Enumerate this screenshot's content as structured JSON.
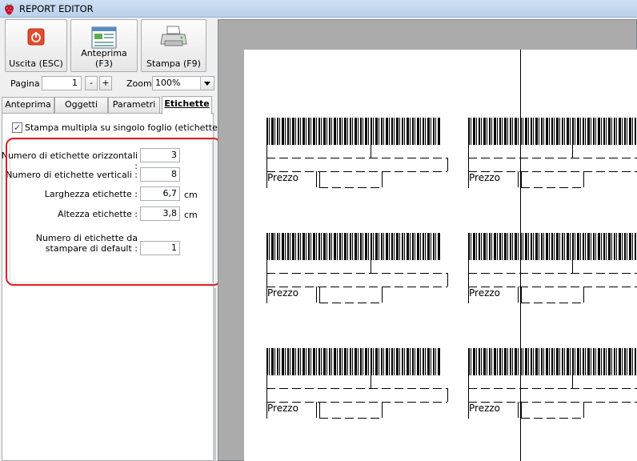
{
  "window": {
    "title": "REPORT EDITOR"
  },
  "toolbar": {
    "exit_label": "Uscita (ESC)",
    "preview_label": "Anteprima (F3)",
    "print_label": "Stampa (F9)"
  },
  "page": {
    "label": "Pagina",
    "value": "1",
    "minus": "-",
    "plus": "+"
  },
  "zoom": {
    "label": "Zoom",
    "value": "100%"
  },
  "tabs": [
    {
      "label": "Anteprima"
    },
    {
      "label": "Oggetti"
    },
    {
      "label": "Parametri"
    },
    {
      "label": "Etichette"
    }
  ],
  "labels_tab": {
    "multi_print_label": "Stampa multipla su singolo foglio (etichette)",
    "multi_print_checked": true,
    "fields": [
      {
        "label": "Numero di etichette orizzontali :",
        "value": "3",
        "unit": ""
      },
      {
        "label": "Numero di etichette verticali :",
        "value": "8",
        "unit": ""
      },
      {
        "label": "Larghezza etichette :",
        "value": "6,7",
        "unit": "cm"
      },
      {
        "label": "Altezza etichette :",
        "value": "3,8",
        "unit": "cm"
      }
    ],
    "default_count_label_1": "Numero di etichette da",
    "default_count_label_2": "stampare di default :",
    "default_count_value": "1"
  },
  "preview": {
    "price_text": "Prezzo"
  },
  "colors": {
    "highlight": "#e02020",
    "titlebar": "#b9d1ea"
  }
}
